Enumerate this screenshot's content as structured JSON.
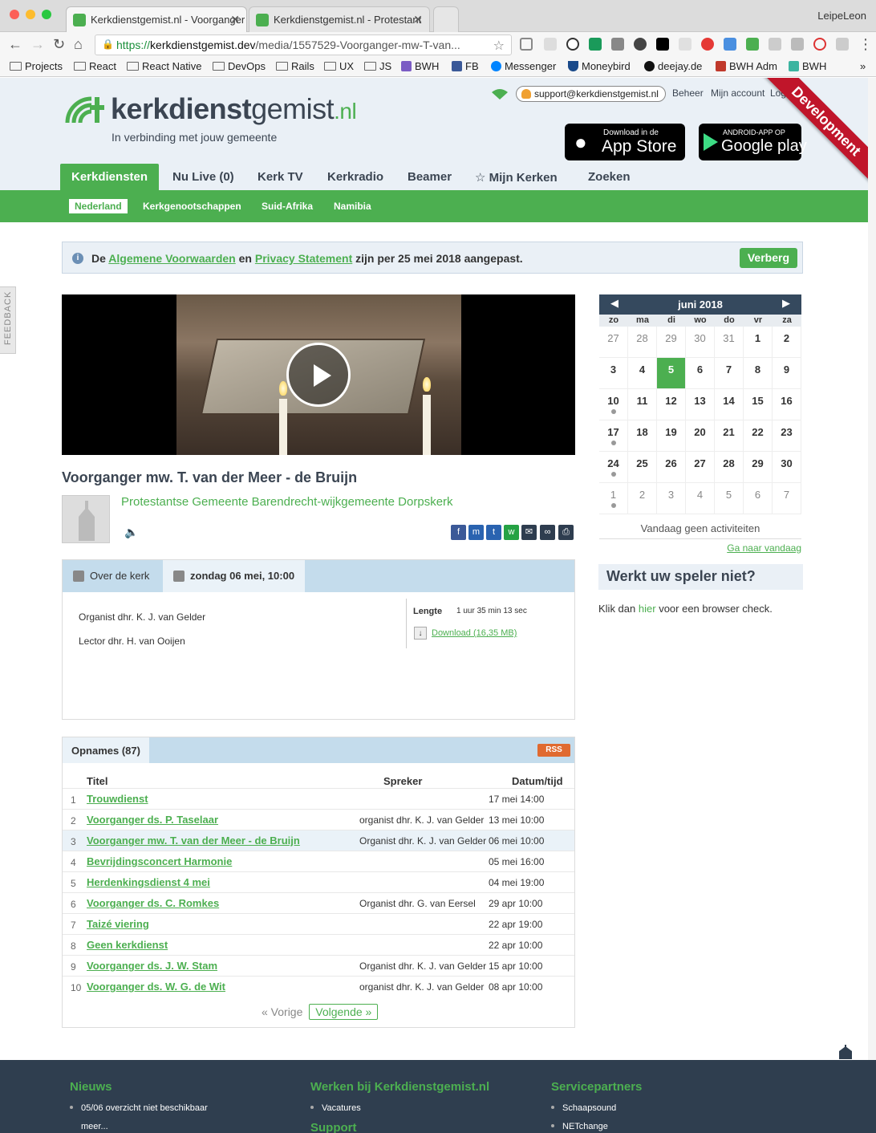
{
  "browser": {
    "tabs": [
      {
        "title": "Kerkdienstgemist.nl - Voorganger",
        "active": true
      },
      {
        "title": "Kerkdienstgemist.nl - Protestant",
        "active": false
      }
    ],
    "profile": "LeipeLeon",
    "url_scheme": "https://",
    "url_host": "kerkdienstgemist.dev",
    "url_path": "/media/1557529-Voorganger-mw-T-van...",
    "bookmarks": [
      "Projects",
      "React",
      "React Native",
      "DevOps",
      "Rails",
      "UX",
      "JS",
      "BWH",
      "FB",
      "Messenger",
      "Moneybird",
      "deejay.de",
      "BWH Adm",
      "BWH"
    ],
    "more_bookmarks": "»"
  },
  "header": {
    "logo_bold": "kerkdienst",
    "logo_light": "gemist",
    "logo_tld": ".nl",
    "tagline": "In verbinding met jouw gemeente",
    "support_email": "support@kerkdienstgemist.nl",
    "links": [
      "Beheer",
      "Mijn account",
      "Log uit"
    ],
    "appstore_small": "Download in de",
    "appstore_big": "App Store",
    "play_small": "ANDROID-APP OP",
    "play_big": "Google play",
    "ribbon": "Development"
  },
  "nav": {
    "items": [
      "Kerkdiensten",
      "Nu Live (0)",
      "Kerk TV",
      "Kerkradio",
      "Beamer",
      "☆ Mijn Kerken",
      "Zoeken"
    ],
    "sub_items": [
      "Nederland",
      "Kerkgenootschappen",
      "Suid-Afrika",
      "Namibia"
    ]
  },
  "notice": {
    "pre": "De",
    "link1": "Algemene Voorwaarden",
    "mid": "en",
    "link2": "Privacy Statement",
    "post": "zijn per 25 mei 2018 aangepast.",
    "button": "Verberg"
  },
  "feedback": "FEEDBACK",
  "service": {
    "title": "Voorganger mw. T. van der Meer - de Bruijn",
    "church": "Protestantse Gemeente Barendrecht-wijkgemeente Dorpskerk",
    "share_icons": [
      "facebook-icon",
      "messenger-icon",
      "twitter-icon",
      "whatsapp-icon",
      "email-icon",
      "link-icon",
      "print-icon"
    ]
  },
  "details": {
    "tab_about": "Over de kerk",
    "tab_date": "zondag 06 mei, 10:00",
    "credits": [
      "Organist dhr. K. J. van Gelder",
      "Lector dhr. H. van Ooijen"
    ],
    "length_label": "Lengte",
    "length_value": "1 uur 35 min 13 sec",
    "download": "Download (16,35 MB)"
  },
  "recordings": {
    "heading": "Opnames (87)",
    "rss": "RSS",
    "col_title": "Titel",
    "col_speaker": "Spreker",
    "col_datetime": "Datum/tijd",
    "rows": [
      {
        "n": "1",
        "title": "Trouwdienst",
        "speaker": "",
        "datetime": "17 mei 14:00"
      },
      {
        "n": "2",
        "title": "Voorganger ds. P. Taselaar",
        "speaker": "organist dhr. K. J. van Gelder",
        "datetime": "13 mei 10:00"
      },
      {
        "n": "3",
        "title": "Voorganger mw. T. van der Meer - de Bruijn",
        "speaker": "Organist dhr. K. J. van Gelder",
        "datetime": "06 mei 10:00"
      },
      {
        "n": "4",
        "title": "Bevrijdingsconcert Harmonie",
        "speaker": "",
        "datetime": "05 mei 16:00"
      },
      {
        "n": "5",
        "title": "Herdenkingsdienst 4 mei",
        "speaker": "",
        "datetime": "04 mei 19:00"
      },
      {
        "n": "6",
        "title": "Voorganger ds. C. Romkes",
        "speaker": "Organist dhr. G. van Eersel",
        "datetime": "29 apr 10:00"
      },
      {
        "n": "7",
        "title": "Taizé viering",
        "speaker": "",
        "datetime": "22 apr 19:00"
      },
      {
        "n": "8",
        "title": "Geen kerkdienst",
        "speaker": "",
        "datetime": "22 apr 10:00"
      },
      {
        "n": "9",
        "title": "Voorganger ds. J. W. Stam",
        "speaker": "Organist dhr. K. J. van Gelder",
        "datetime": "15 apr 10:00"
      },
      {
        "n": "10",
        "title": "Voorganger ds. W. G. de Wit",
        "speaker": "organist dhr. K. J. van Gelder",
        "datetime": "08 apr 10:00"
      }
    ],
    "prev": "« Vorige",
    "next": "Volgende »"
  },
  "calendar": {
    "month": "juni 2018",
    "dows": [
      "zo",
      "ma",
      "di",
      "wo",
      "do",
      "vr",
      "za"
    ],
    "weeks": [
      [
        "27",
        "28",
        "29",
        "30",
        "31",
        "1",
        "2"
      ],
      [
        "3",
        "4",
        "5",
        "6",
        "7",
        "8",
        "9"
      ],
      [
        "10",
        "11",
        "12",
        "13",
        "14",
        "15",
        "16"
      ],
      [
        "17",
        "18",
        "19",
        "20",
        "21",
        "22",
        "23"
      ],
      [
        "24",
        "25",
        "26",
        "27",
        "28",
        "29",
        "30"
      ],
      [
        "1",
        "2",
        "3",
        "4",
        "5",
        "6",
        "7"
      ]
    ],
    "no_activity": "Vandaag geen activiteiten",
    "goto_today": "Ga naar vandaag"
  },
  "player_help": {
    "heading": "Werkt uw speler niet?",
    "pre": "Klik dan",
    "link": "hier",
    "post": "voor een browser check."
  },
  "footer": {
    "col1_title": "Nieuws",
    "col1_items": [
      "05/06 overzicht niet beschikbaar",
      "meer..."
    ],
    "col2_title": "Werken bij Kerkdienstgemist.nl",
    "col2_items": [
      "Vacatures"
    ],
    "col2b_title": "Support",
    "col3_title": "Servicepartners",
    "col3_items": [
      "Schaapsound",
      "NETchange"
    ]
  },
  "colors": {
    "brand_green": "#4caf50",
    "nav_dark": "#3b4552",
    "header_bg": "#eaf0f6",
    "ribbon_red": "#c0152a",
    "footer_bg": "#2f3e4f"
  }
}
